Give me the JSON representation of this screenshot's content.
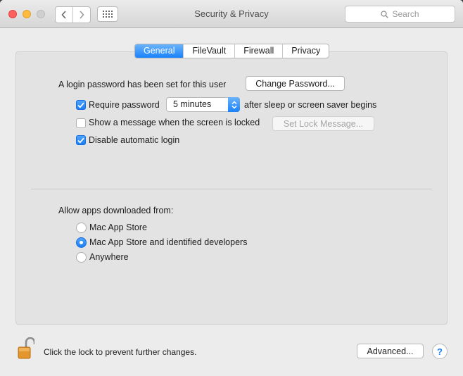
{
  "window": {
    "title": "Security & Privacy"
  },
  "toolbar": {
    "search_placeholder": "Search",
    "back_icon": "chevron-left-icon",
    "forward_icon": "chevron-right-icon",
    "show_all_icon": "grid-icon"
  },
  "tabs": [
    {
      "label": "General",
      "selected": true
    },
    {
      "label": "FileVault",
      "selected": false
    },
    {
      "label": "Firewall",
      "selected": false
    },
    {
      "label": "Privacy",
      "selected": false
    }
  ],
  "general": {
    "login_password_text": "A login password has been set for this user",
    "change_password_button": "Change Password...",
    "require_password": {
      "label": "Require password",
      "checked": true,
      "interval": "5 minutes",
      "suffix": "after sleep or screen saver begins"
    },
    "show_message": {
      "label": "Show a message when the screen is locked",
      "checked": false,
      "button": "Set Lock Message..."
    },
    "disable_auto_login": {
      "label": "Disable automatic login",
      "checked": true
    }
  },
  "downloads": {
    "heading": "Allow apps downloaded from:",
    "options": [
      {
        "label": "Mac App Store",
        "selected": false
      },
      {
        "label": "Mac App Store and identified developers",
        "selected": true
      },
      {
        "label": "Anywhere",
        "selected": false
      }
    ]
  },
  "footer": {
    "lock_text": "Click the lock to prevent further changes.",
    "advanced_button": "Advanced...",
    "help_button": "?",
    "lock_icon": "unlocked-padlock-icon"
  },
  "colors": {
    "accent": "#1a7ef5",
    "close": "#fc615d",
    "minimize": "#fdbc40"
  }
}
